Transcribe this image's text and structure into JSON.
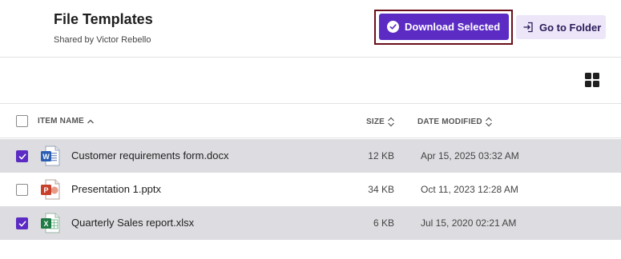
{
  "header": {
    "title": "File Templates",
    "subtitle": "Shared by Victor Rebello",
    "download_label": "Download Selected",
    "goto_label": "Go to Folder"
  },
  "columns": {
    "name": "ITEM NAME",
    "size": "SIZE",
    "date": "DATE MODIFIED"
  },
  "files": [
    {
      "name": "Customer requirements form.docx",
      "size": "12 KB",
      "date": "Apr 15, 2025 03:32 AM",
      "selected": true,
      "type": "word"
    },
    {
      "name": "Presentation 1.pptx",
      "size": "34 KB",
      "date": "Oct 11, 2023 12:28 AM",
      "selected": false,
      "type": "powerpoint"
    },
    {
      "name": "Quarterly Sales report.xlsx",
      "size": "6 KB",
      "date": "Jul 15, 2020 02:21 AM",
      "selected": true,
      "type": "excel"
    }
  ],
  "colors": {
    "accent": "#5b2bc4",
    "selected_row": "#dddde1",
    "word": "#2b5fb3",
    "powerpoint": "#c8402a",
    "excel": "#1f7a44"
  }
}
